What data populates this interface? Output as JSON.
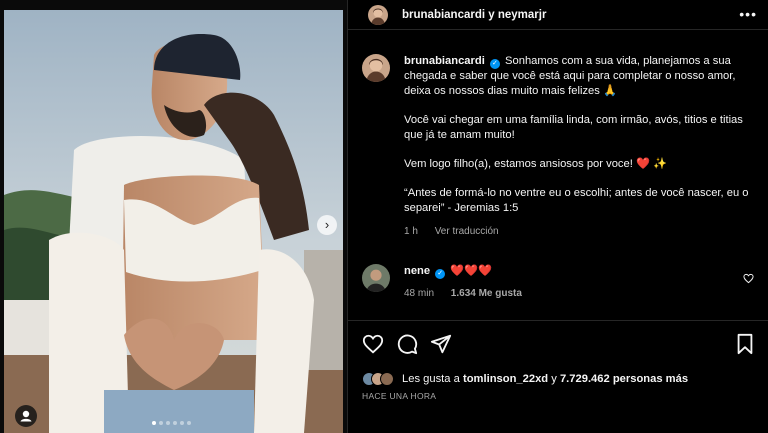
{
  "header": {
    "title": "brunabiancardi y neymarjr",
    "more_glyph": "•••"
  },
  "caption": {
    "username": "brunabiancardi",
    "para1": "Sonhamos com a sua vida, planejamos a sua chegada e saber que você está aqui para completar o nosso amor, deixa os nossos dias muito mais felizes 🙏",
    "para2": "Você vai chegar em uma família linda, com irmão, avós, titios e titias que já te amam muito!",
    "para3": "Vem logo filho(a), estamos ansiosos por voce! ❤️ ✨",
    "para4": "“Antes de formá-lo no ventre eu o escolhi; antes de você nascer, eu o separei” - Jeremias 1:5",
    "time": "1 h",
    "translate": "Ver traducción"
  },
  "comment": {
    "username": "nene",
    "text": "❤️❤️❤️",
    "time": "48 min",
    "likes": "1.634 Me gusta"
  },
  "likes": {
    "prefix": "Les gusta a",
    "user": "tomlinson_22xd",
    "middle": "y",
    "count": "7.729.462 personas más"
  },
  "timestamp": "HACE UNA HORA",
  "carousel": {
    "count": 6,
    "active": 0
  },
  "icons": {
    "like": "heart-icon",
    "comment": "comment-icon",
    "share": "share-icon",
    "save": "bookmark-icon",
    "next": "chevron-right-icon",
    "tag": "user-tag-icon"
  },
  "colors": {
    "verified": "#0095f6",
    "background": "#000000",
    "secondary_text": "#a8a8a8"
  }
}
